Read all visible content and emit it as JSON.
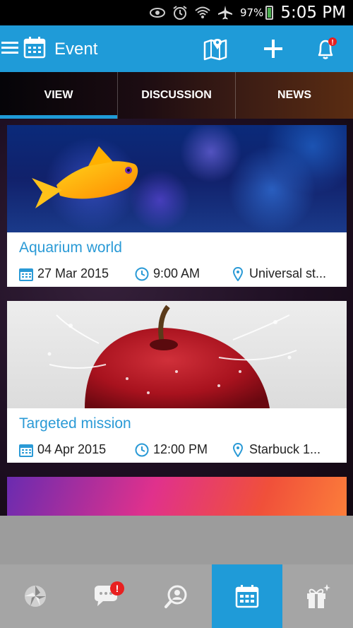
{
  "status_bar": {
    "battery": "97%",
    "time": "5:05 PM"
  },
  "app_bar": {
    "title": "Event",
    "accent": "#1f9bd8"
  },
  "tabs": [
    {
      "label": "VIEW",
      "active": true
    },
    {
      "label": "DISCUSSION",
      "active": false
    },
    {
      "label": "NEWS",
      "active": false
    }
  ],
  "events": [
    {
      "title": "Aquarium world",
      "date": "27 Mar 2015",
      "time": "9:00 AM",
      "place": "Universal st..."
    },
    {
      "title": "Targeted mission",
      "date": "04 Apr 2015",
      "time": "12:00 PM",
      "place": "Starbuck 1..."
    }
  ],
  "bottom_nav": {
    "items": [
      {
        "icon": "shutter-icon",
        "active": false
      },
      {
        "icon": "chat-icon",
        "active": false,
        "badge": "!"
      },
      {
        "icon": "profile-search-icon",
        "active": false
      },
      {
        "icon": "calendar-icon",
        "active": true
      },
      {
        "icon": "gift-icon",
        "active": false
      }
    ]
  },
  "notifications_badge": "!"
}
